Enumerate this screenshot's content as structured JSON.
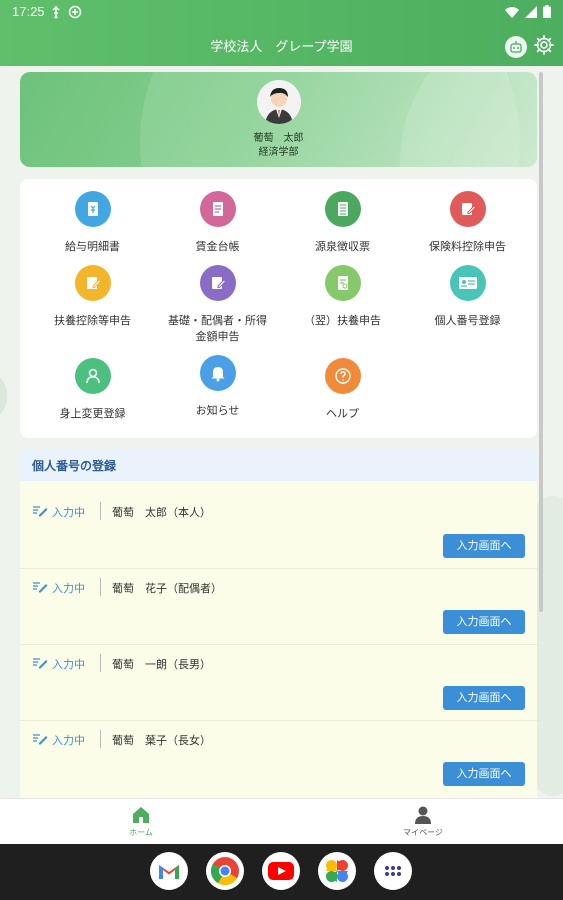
{
  "status_bar": {
    "time": "17:25"
  },
  "header": {
    "title": "学校法人　グレープ学園"
  },
  "profile": {
    "name": "葡萄　太郎",
    "department": "経済学部"
  },
  "menu": {
    "items": [
      {
        "label": "給与明細書",
        "color": "#42a7e0",
        "icon": "payslip-icon"
      },
      {
        "label": "賃金台帳",
        "color": "#d2679a",
        "icon": "ledger-icon"
      },
      {
        "label": "源泉徴収票",
        "color": "#4da85f",
        "icon": "withholding-slip-icon"
      },
      {
        "label": "保険料控除申告",
        "color": "#e05a5a",
        "icon": "insurance-edit-icon"
      },
      {
        "label": "扶養控除等申告",
        "color": "#f2b52c",
        "icon": "dependent-edit-icon"
      },
      {
        "label": "基礎・配偶者・所得\n金額申告",
        "color": "#8a6cc6",
        "icon": "basic-edit-icon"
      },
      {
        "label": "（翌）扶養申告",
        "color": "#86c96a",
        "icon": "next-dependent-icon"
      },
      {
        "label": "個人番号登録",
        "color": "#49c4b9",
        "icon": "id-card-icon"
      },
      {
        "label": "身上変更登録",
        "color": "#4cc07f",
        "icon": "person-icon"
      },
      {
        "label": "お知らせ",
        "color": "#4a9fe6",
        "icon": "bell-icon"
      },
      {
        "label": "ヘルプ",
        "color": "#f08b3c",
        "icon": "help-icon"
      }
    ]
  },
  "registration": {
    "title": "個人番号の登録",
    "rows": [
      {
        "status": "入力中",
        "name": "葡萄　太郎（本人）",
        "button": "入力画面へ"
      },
      {
        "status": "入力中",
        "name": "葡萄　花子（配偶者）",
        "button": "入力画面へ"
      },
      {
        "status": "入力中",
        "name": "葡萄　一朗（長男）",
        "button": "入力画面へ"
      },
      {
        "status": "入力中",
        "name": "葡萄　葉子（長女）",
        "button": "入力画面へ"
      }
    ]
  },
  "bottom_nav": {
    "home": "ホーム",
    "mypage": "マイページ"
  },
  "colors": {
    "accent": "#4cae5e",
    "button": "#3b8fd6",
    "status": "#3a8fd8"
  }
}
